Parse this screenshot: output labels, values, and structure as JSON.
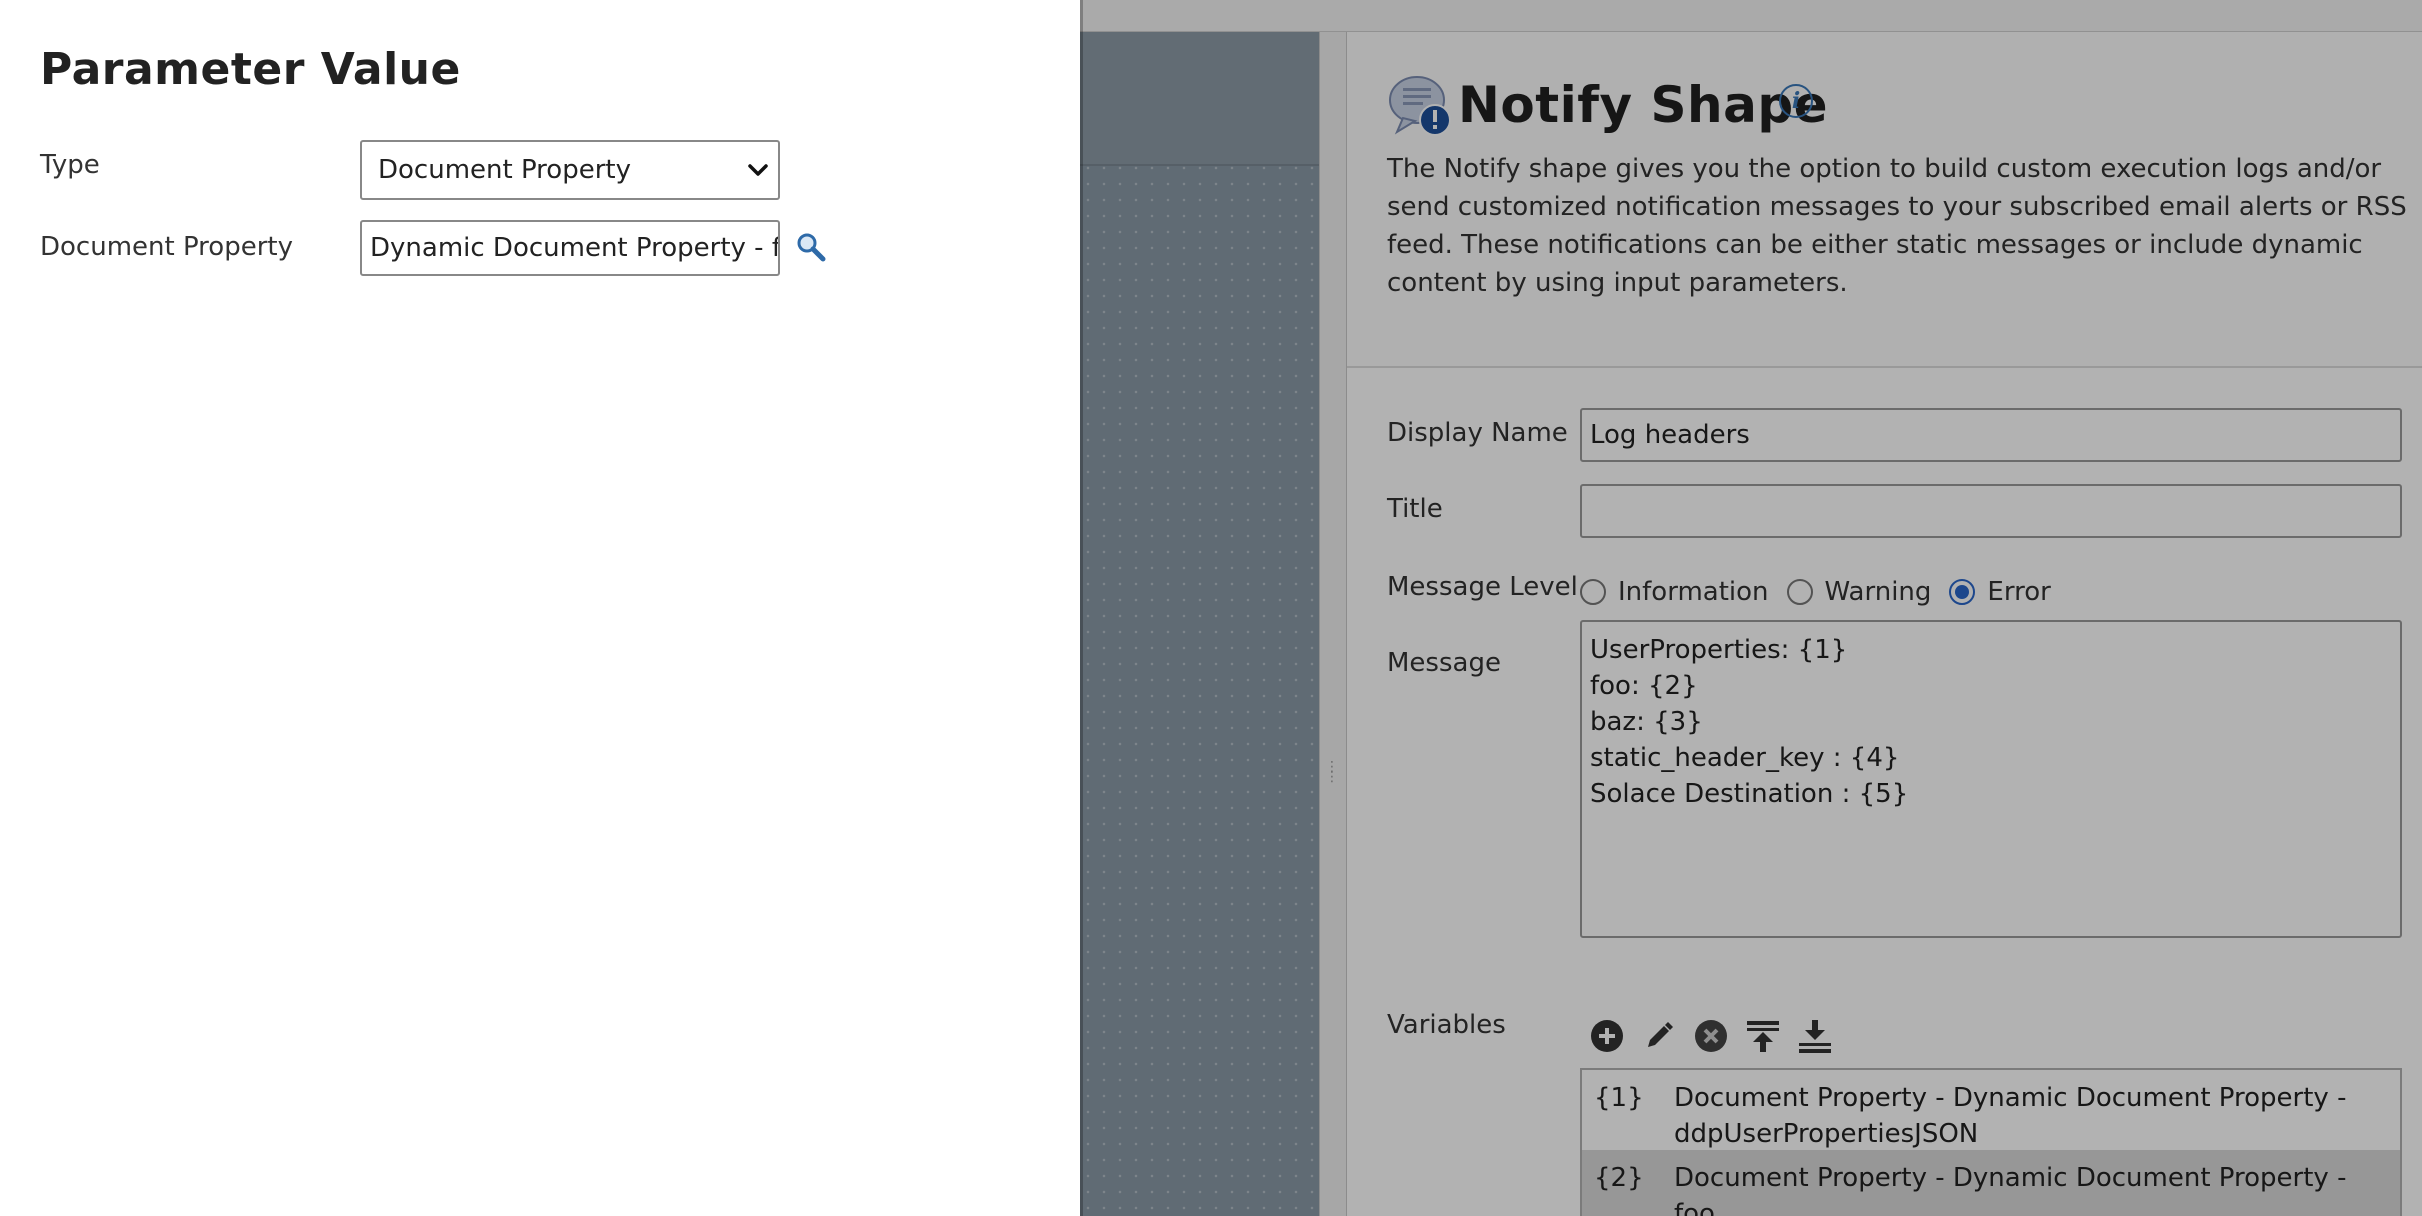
{
  "dialog": {
    "title": "Parameter Value",
    "type_label": "Type",
    "type_value": "Document Property",
    "doc_property_label": "Document Property",
    "doc_property_value": "Dynamic Document Property - foo"
  },
  "notify": {
    "title": "Notify Shape",
    "description": "The Notify shape gives you the option to build custom execution logs and/or send customized notification messages to your subscribed email alerts or RSS feed. These notifications can be either static messages or include dynamic content by using input parameters.",
    "display_name_label": "Display Name",
    "display_name_value": "Log headers",
    "title_label": "Title",
    "title_value": "",
    "message_level_label": "Message Level",
    "message_levels": [
      "Information",
      "Warning",
      "Error"
    ],
    "message_level_selected": "Error",
    "message_label": "Message",
    "message_lines": [
      "UserProperties: {1}",
      "foo: {2}",
      "baz: {3}",
      "static_header_key : {4}",
      "Solace Destination : {5}"
    ],
    "variables_label": "Variables",
    "toolbar_icons": [
      "add-icon",
      "edit-icon",
      "remove-icon",
      "move-top-icon",
      "move-bottom-icon"
    ],
    "variables": [
      {
        "key": "{1}",
        "value": "Document Property - Dynamic Document Property - ddpUserPropertiesJSON"
      },
      {
        "key": "{2}",
        "value": "Document Property - Dynamic Document Property - foo"
      }
    ]
  },
  "colors": {
    "accent": "#2a66c9",
    "info_icon": "#3a78b8"
  }
}
